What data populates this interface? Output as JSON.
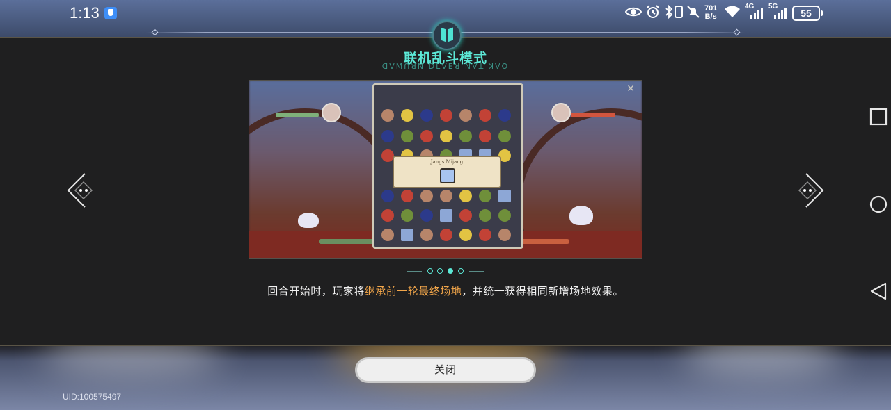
{
  "status_bar": {
    "time": "1:13",
    "net_speed_value": "701",
    "net_speed_unit": "B/s",
    "signal_4g": "4G",
    "signal_5g": "5G",
    "battery_level": "55",
    "icons": [
      "shield-icon",
      "eye-icon",
      "alarm-icon",
      "bluetooth-icon",
      "vibrate-icon",
      "mute-icon",
      "wifi-icon",
      "signal-4g-icon",
      "signal-5g-icon",
      "battery-icon"
    ]
  },
  "dialog": {
    "title": "联机乱斗模式",
    "subtitle_glyphs": "ꓷꓯꓟꓵꓤꓠ ꓓꓡꓯꓰꓤ ꓠꓯꓕ ꓘꓯꓳ",
    "preview": {
      "popup_title": "Jangs Mijang",
      "icons": [
        "close-icon",
        "tile-icon"
      ]
    },
    "pager": {
      "count": 4,
      "active_index": 2
    },
    "description": {
      "before": "回合开始时，玩家将",
      "highlight": "继承前一轮最终场地",
      "after": "，并统一获得相同新增场地效果。"
    },
    "accent_color": "#5ce8d6",
    "highlight_color": "#f2a64a"
  },
  "buttons": {
    "close_label": "关闭"
  },
  "footer": {
    "uid": "UID:100575497"
  },
  "system_nav": [
    "recent-apps-icon",
    "home-icon",
    "back-icon"
  ]
}
